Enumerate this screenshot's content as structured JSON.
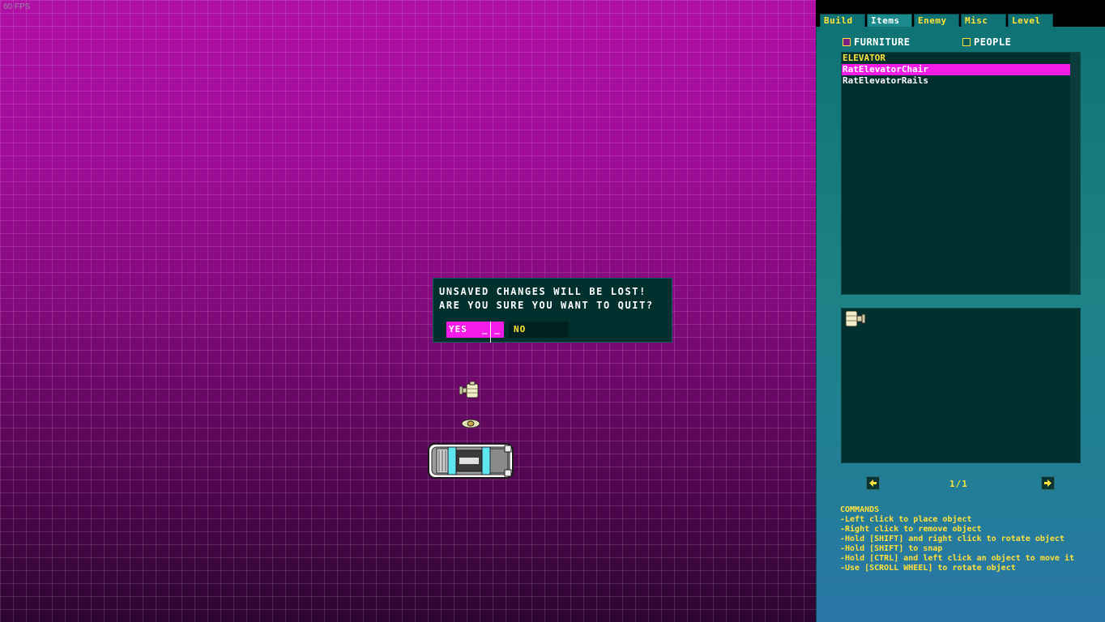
{
  "fps": "60 FPS",
  "dialog": {
    "line1": "UNSAVED CHANGES WILL BE LOST!",
    "line2": "ARE YOU SURE YOU WANT TO QUIT?",
    "yes_label": "YES",
    "yes_marks": "_ _",
    "no_label": "NO"
  },
  "tabs": [
    "Build",
    "Items",
    "Enemy",
    "Misc",
    "Level"
  ],
  "active_tab": "Items",
  "filters": {
    "furniture": {
      "label": "FURNITURE",
      "checked": true
    },
    "people": {
      "label": "PEOPLE",
      "checked": false
    }
  },
  "item_list": {
    "category": "ELEVATOR",
    "items": [
      "RatElevatorChair",
      "RatElevatorRails"
    ],
    "selected": "RatElevatorChair"
  },
  "pagination": {
    "page": "1/1"
  },
  "commands": [
    "COMMANDS",
    "-Left click to place object",
    "-Right click to remove object",
    "-Hold [SHIFT] and right click to rotate object",
    "-Hold [SHIFT] to snap",
    "-Hold [CTRL] and left click an object to move it",
    "-Use [SCROLL WHEEL] to rotate object"
  ],
  "colors": {
    "highlight": "#f21ce6",
    "accent_text": "#ffe23a",
    "panel": "#0f7375",
    "dialog_bg": "#02302e"
  },
  "icons": {
    "chair": "elevator-chair-icon",
    "car": "car-icon",
    "prev": "arrow-left-icon",
    "next": "arrow-right-icon"
  }
}
